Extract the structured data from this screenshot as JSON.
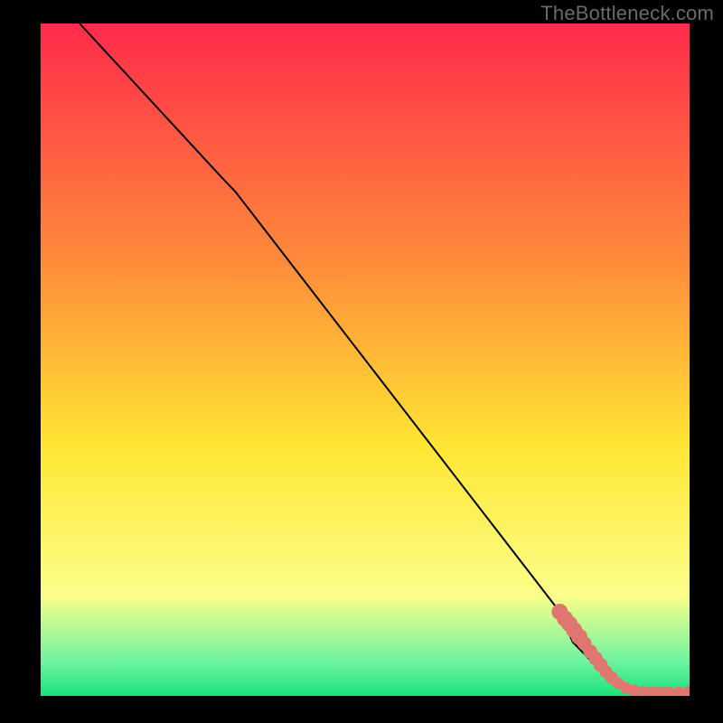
{
  "branding": {
    "watermark": "TheBottleneck.com"
  },
  "colors": {
    "gradient_top": "#ff2a4b",
    "gradient_mid_upper": "#ff8a3a",
    "gradient_mid": "#ffe633",
    "gradient_lower_yellow": "#fbff8a",
    "gradient_green_light": "#6df3a0",
    "gradient_green": "#18e27a",
    "line": "#000000",
    "marker": "#e07670",
    "background": "#000000"
  },
  "chart_data": {
    "type": "line",
    "title": "",
    "xlabel": "",
    "ylabel": "",
    "xlim": [
      0,
      100
    ],
    "ylim": [
      0,
      100
    ],
    "grid": false,
    "series": [
      {
        "name": "curve",
        "x": [
          6,
          28,
          30,
          40,
          50,
          60,
          70,
          80,
          82,
          85,
          88,
          90,
          92,
          95,
          100
        ],
        "values": [
          100,
          77,
          75,
          62.5,
          50,
          37.5,
          25,
          12.5,
          8,
          5,
          2.5,
          1.5,
          1,
          0.5,
          0.5
        ]
      }
    ],
    "markers": {
      "name": "data-points",
      "points": [
        {
          "x": 80,
          "y": 12.5,
          "r": 1.4
        },
        {
          "x": 80.8,
          "y": 11.5,
          "r": 1.4
        },
        {
          "x": 81.5,
          "y": 10.7,
          "r": 1.4
        },
        {
          "x": 82.2,
          "y": 9.8,
          "r": 1.4
        },
        {
          "x": 83.0,
          "y": 8.8,
          "r": 1.4
        },
        {
          "x": 83.8,
          "y": 7.8,
          "r": 1.2
        },
        {
          "x": 84.7,
          "y": 6.6,
          "r": 1.2
        },
        {
          "x": 85.5,
          "y": 5.6,
          "r": 1.2
        },
        {
          "x": 86.3,
          "y": 4.6,
          "r": 1.2
        },
        {
          "x": 87.1,
          "y": 3.6,
          "r": 1.1
        },
        {
          "x": 88.0,
          "y": 2.7,
          "r": 1.1
        },
        {
          "x": 89.0,
          "y": 1.9,
          "r": 1.0
        },
        {
          "x": 90.2,
          "y": 1.2,
          "r": 1.0
        },
        {
          "x": 91.5,
          "y": 0.8,
          "r": 1.0
        },
        {
          "x": 93.0,
          "y": 0.6,
          "r": 1.0
        },
        {
          "x": 94.3,
          "y": 0.5,
          "r": 1.0
        },
        {
          "x": 95.5,
          "y": 0.5,
          "r": 1.0
        },
        {
          "x": 96.8,
          "y": 0.5,
          "r": 1.0
        },
        {
          "x": 98.3,
          "y": 0.5,
          "r": 1.0
        },
        {
          "x": 100,
          "y": 0.5,
          "r": 1.2
        }
      ]
    }
  }
}
